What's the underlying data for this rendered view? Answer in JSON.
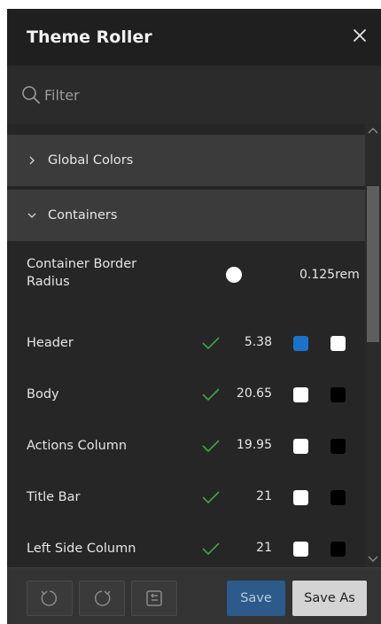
{
  "dialog": {
    "title": "Theme Roller",
    "close_icon": "close-icon"
  },
  "filter": {
    "placeholder": "Filter",
    "icon": "search-icon"
  },
  "groups": [
    {
      "label": "Global Colors",
      "expanded": false,
      "icon": "chevron-right-icon"
    },
    {
      "label": "Containers",
      "expanded": true,
      "icon": "chevron-down-icon"
    }
  ],
  "container_border_radius": {
    "label_line1": "Container Border",
    "label_line2": "Radius",
    "value": "0.125rem"
  },
  "properties": [
    {
      "label": "Header",
      "ratio": "5.38",
      "bg_color": "#1a73c8",
      "fg_color": "#ffffff"
    },
    {
      "label": "Body",
      "ratio": "20.65",
      "bg_color": "#ffffff",
      "fg_color": "#000000"
    },
    {
      "label": "Actions Column",
      "ratio": "19.95",
      "bg_color": "#ffffff",
      "fg_color": "#000000"
    },
    {
      "label": "Title Bar",
      "ratio": "21",
      "bg_color": "#ffffff",
      "fg_color": "#000000"
    },
    {
      "label": "Left Side Column",
      "ratio": "21",
      "bg_color": "#ffffff",
      "fg_color": "#000000"
    }
  ],
  "colors": {
    "check": "#3fa34d",
    "accent": "#2c5a8a"
  },
  "footer": {
    "undo_icon": "undo-icon",
    "redo_icon": "redo-icon",
    "reset_icon": "reset-icon",
    "save_label": "Save",
    "save_as_label": "Save As"
  }
}
